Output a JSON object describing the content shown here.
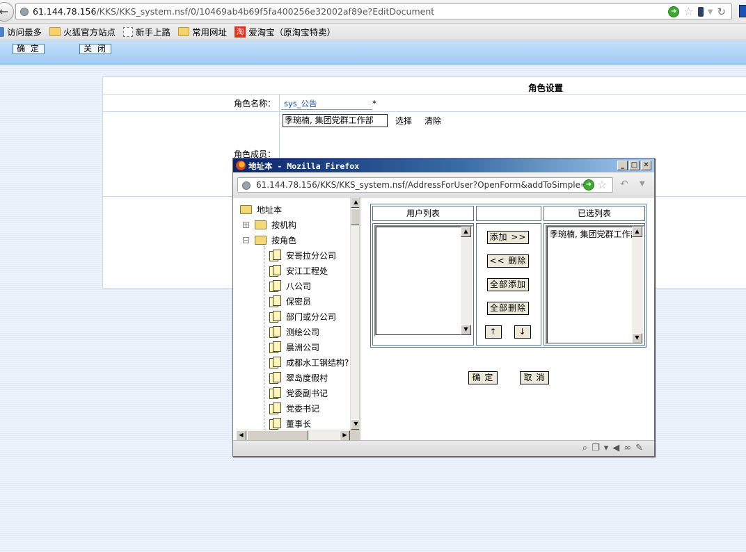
{
  "browser": {
    "url_host": "61.144.78.156",
    "url_path": "/KKS/KKS_system.nsf/0/10469ab4b69f5fa400256e32002af89e?EditDocument",
    "bookmarks": [
      {
        "label": "访问最多",
        "icon": "most-visited-icon"
      },
      {
        "label": "火狐官方站点",
        "icon": "folder-icon"
      },
      {
        "label": "新手上路",
        "icon": "blank-page-icon"
      },
      {
        "label": "常用网址",
        "icon": "folder-icon"
      },
      {
        "label": "爱淘宝（原淘宝特卖）",
        "icon": "taobao-icon",
        "badge": "淘"
      }
    ]
  },
  "page": {
    "toolbar": {
      "confirm": "确 定",
      "close": "关 闭"
    },
    "form_title": "角色设置",
    "role_name_label": "角色名称：",
    "role_name_value": "sys_公告",
    "required_mark": "*",
    "members_label": "角色成员：",
    "members_value": "季琬楠, 集团党群工作部",
    "select_link": "选择",
    "clear_link": "清除"
  },
  "popup": {
    "title": "地址本 - Mozilla Firefox",
    "url": "61.144.78.156/KKS/KKS_system.nsf/AddressForUser?OpenForm&addToSimple=",
    "tree": {
      "root": "地址本",
      "by_org": "按机构",
      "by_role": "按角色",
      "roles": [
        "安哥拉分公司",
        "安江工程处",
        "八公司",
        "保密员",
        "部门或分公司",
        "测绘公司",
        "晨洲公司",
        "成都水工钢结构?",
        "翠岛度假村",
        "党委副书记",
        "党委书记",
        "董事长"
      ]
    },
    "user_list_header": "用户列表",
    "selected_list_header": "已选列表",
    "selected_items": [
      "季琬楠, 集团党群工作部"
    ],
    "buttons": {
      "add": "添加 >>",
      "remove": "<< 删除",
      "add_all": "全部添加",
      "remove_all": "全部删除",
      "up": "↑",
      "down": "↓",
      "ok": "确 定",
      "cancel": "取 消"
    }
  },
  "colors": {
    "page_header_gradient_top": "#c6e1fb",
    "title_bar": "#0a246a",
    "form_border": "#c5d9ee"
  }
}
